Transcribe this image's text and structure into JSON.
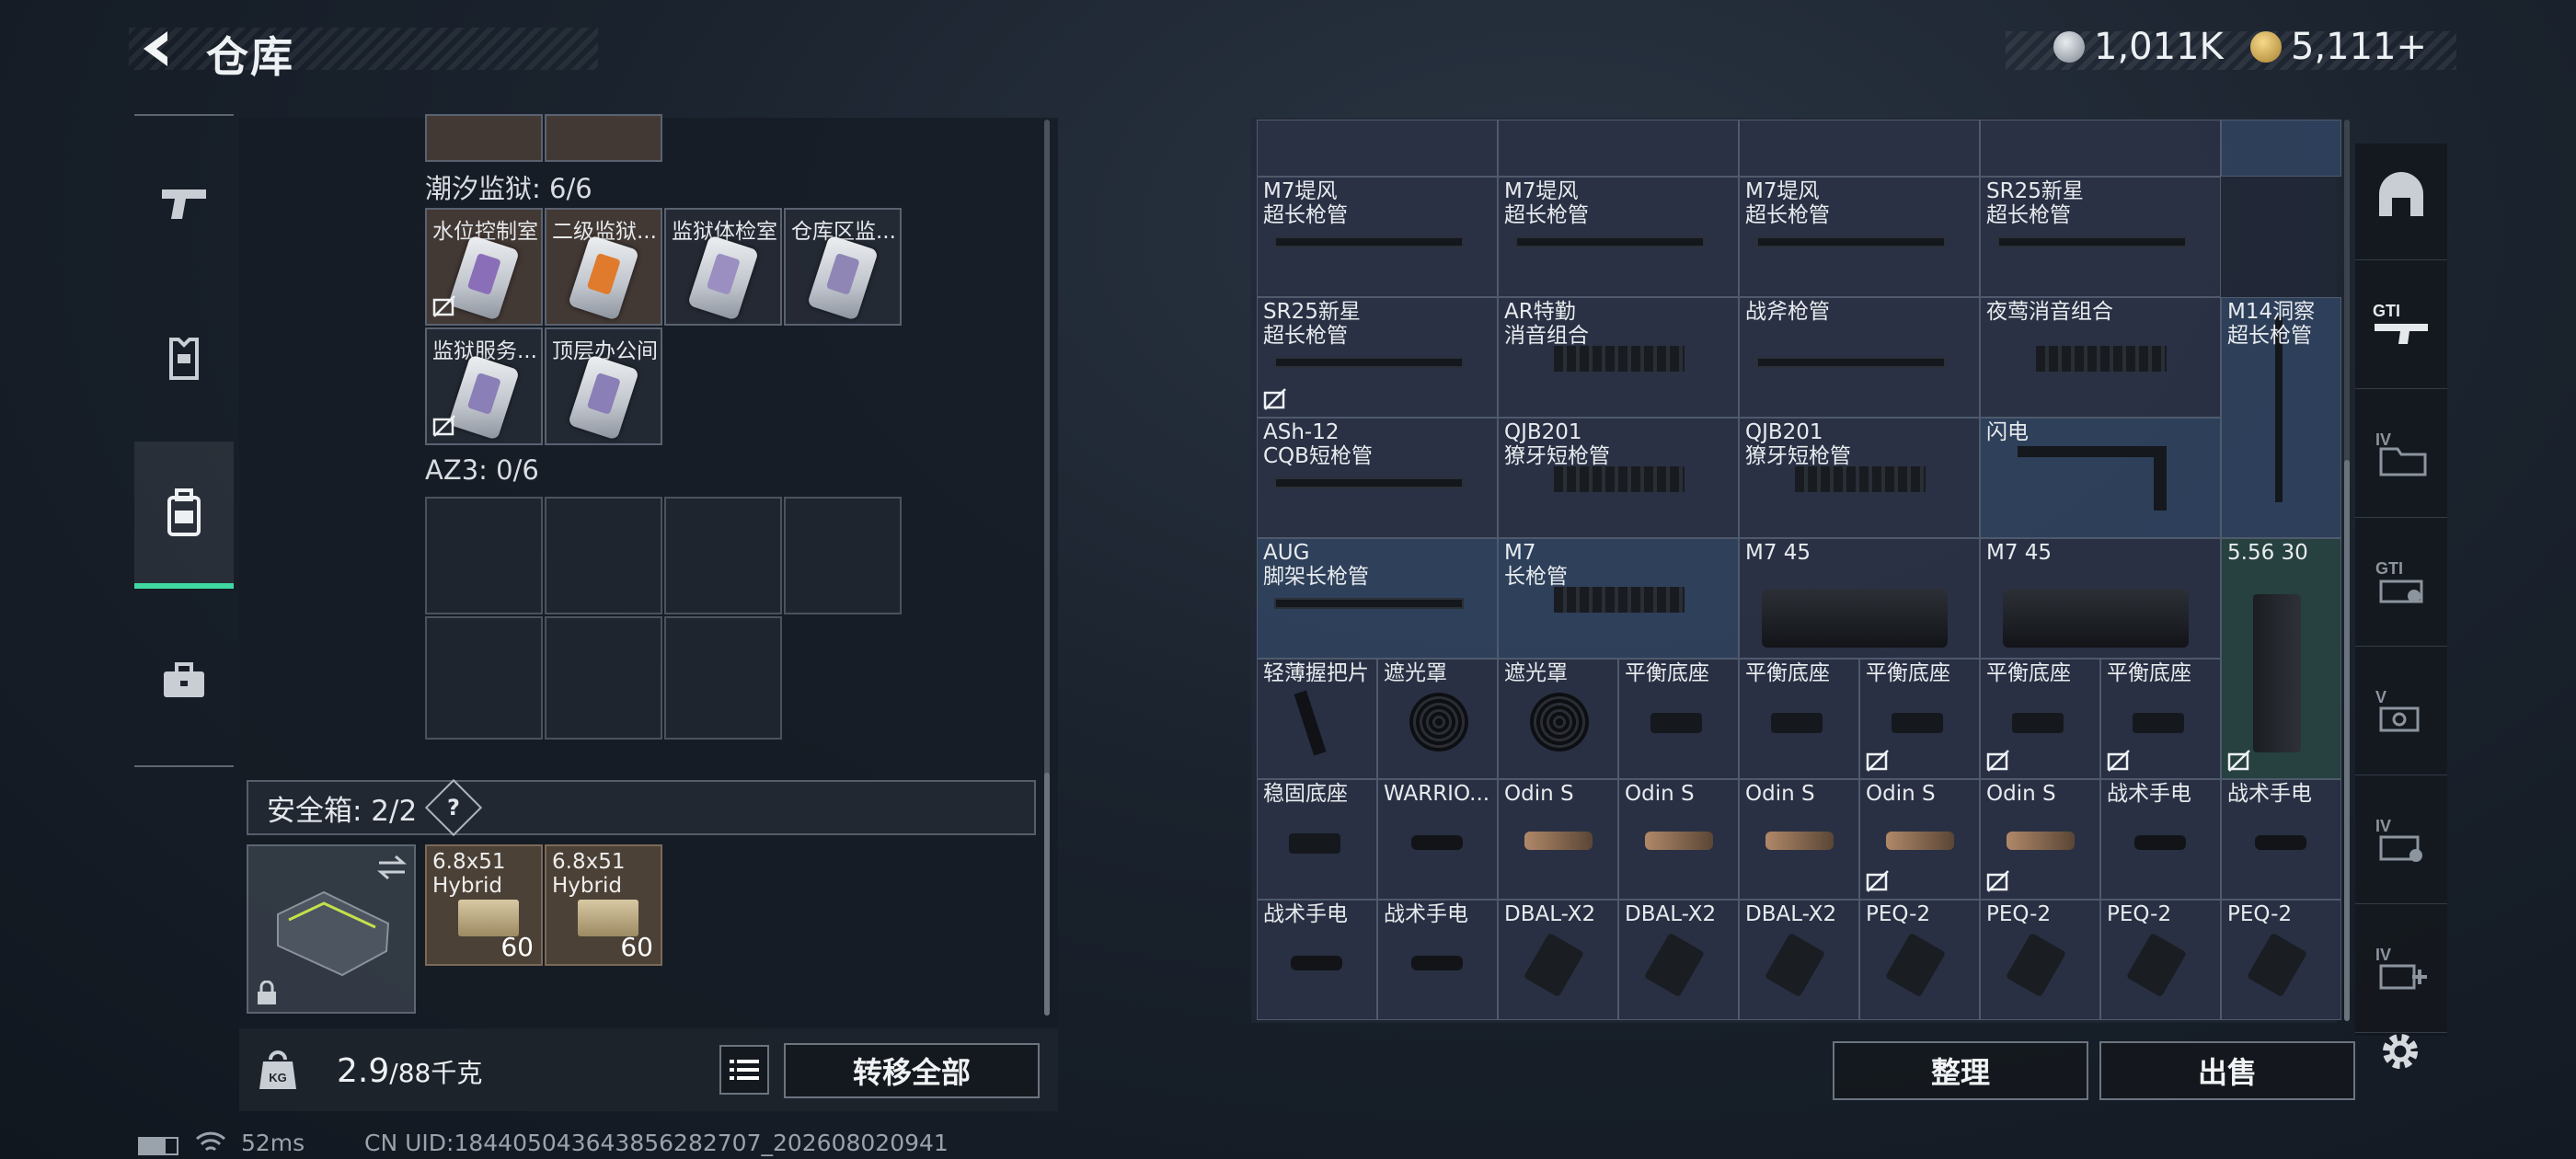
{
  "header": {
    "title": "仓库"
  },
  "currency": {
    "primary": "1,011K",
    "secondary": "5,111+"
  },
  "left_nav": {
    "items": [
      "weapon-tab",
      "armor-tab",
      "backpack-tab",
      "toolbox-tab"
    ],
    "active": 2
  },
  "left_panel": {
    "section_prison": "潮汐监狱: 6/6",
    "keys": [
      {
        "name": "水位控制室",
        "tone": "warm",
        "stripe": "#8a6fb8",
        "unbound": true
      },
      {
        "name": "二级监狱...",
        "tone": "warm",
        "stripe": "#e07a2c",
        "unbound": false
      },
      {
        "name": "监狱体检室",
        "tone": "normal",
        "stripe": "#9a8fc0",
        "unbound": false
      },
      {
        "name": "仓库区监...",
        "tone": "normal",
        "stripe": "#8f86b6",
        "unbound": false
      },
      {
        "name": "监狱服务...",
        "tone": "normal",
        "stripe": "#8a7fb6",
        "unbound": true
      },
      {
        "name": "顶层办公间",
        "tone": "normal",
        "stripe": "#8a7fb6",
        "unbound": false
      }
    ],
    "section_az3": "AZ3: 0/6",
    "safe_box": {
      "label": "安全箱: 2/2",
      "help": "?"
    },
    "ammo": [
      {
        "name": "6.8x51\nHybrid",
        "count": "60"
      },
      {
        "name": "6.8x51\nHybrid",
        "count": "60"
      }
    ],
    "weight": {
      "value": "2.9",
      "unit": "/88千克"
    },
    "transfer_all": "转移全部"
  },
  "grid_items": [
    {
      "name": "M7堤风\n超长枪管"
    },
    {
      "name": "M7堤风\n超长枪管"
    },
    {
      "name": "M7堤风\n超长枪管"
    },
    {
      "name": "SR25新星\n超长枪管"
    },
    {
      "name": "SR25新星\n超长枪管"
    },
    {
      "name": "AR特勤\n消音组合"
    },
    {
      "name": "战斧枪管"
    },
    {
      "name": "夜莺消音组合"
    },
    {
      "name": "M14洞察\n超长枪管"
    },
    {
      "name": "ASh-12\nCQB短枪管"
    },
    {
      "name": "QJB201\n獠牙短枪管"
    },
    {
      "name": "QJB201\n獠牙短枪管"
    },
    {
      "name": "闪电"
    },
    {
      "name": "AUG\n脚架长枪管"
    },
    {
      "name": "M7\n长枪管"
    },
    {
      "name": "M7 45"
    },
    {
      "name": "M7 45"
    },
    {
      "name": "5.56 30"
    },
    {
      "name": "轻薄握把片"
    },
    {
      "name": "遮光罩"
    },
    {
      "name": "遮光罩"
    },
    {
      "name": "平衡底座"
    },
    {
      "name": "平衡底座"
    },
    {
      "name": "平衡底座"
    },
    {
      "name": "平衡底座"
    },
    {
      "name": "平衡底座"
    },
    {
      "name": "稳固底座"
    },
    {
      "name": "WARRIO..."
    },
    {
      "name": "Odin S"
    },
    {
      "name": "Odin S"
    },
    {
      "name": "Odin S"
    },
    {
      "name": "Odin S"
    },
    {
      "name": "Odin S"
    },
    {
      "name": "战术手电"
    },
    {
      "name": "战术手电"
    },
    {
      "name": "战术手电"
    },
    {
      "name": "战术手电"
    },
    {
      "name": "DBAL-X2"
    },
    {
      "name": "DBAL-X2"
    },
    {
      "name": "DBAL-X2"
    },
    {
      "name": "PEQ-2"
    },
    {
      "name": "PEQ-2"
    },
    {
      "name": "PEQ-2"
    },
    {
      "name": "PEQ-2"
    }
  ],
  "right_panel": {
    "sort_button": "整理",
    "sell_button": "出售"
  },
  "right_nav": {
    "items": [
      "helmet-tab",
      "gti-gun-tab",
      "iv-folder-tab",
      "gti-camera-tab",
      "v-device-tab",
      "iv-case-tab",
      "iv-plus-tab"
    ]
  },
  "status_bar": {
    "ping": "52ms",
    "uid": "CN UID:1844050436438562827​07_202608020941"
  }
}
